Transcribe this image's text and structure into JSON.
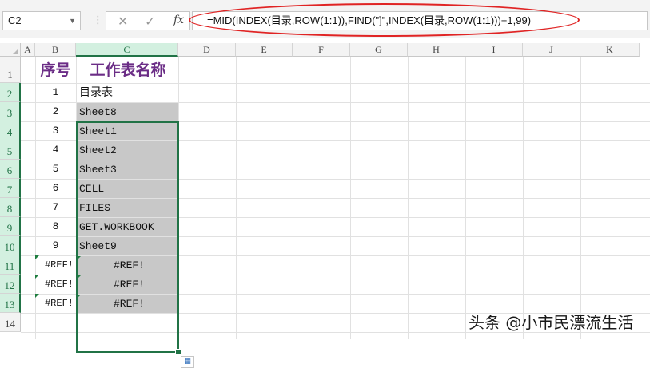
{
  "formula_bar": {
    "name_box": "C2",
    "formula": "=MID(INDEX(目录,ROW(1:1)),FIND(\"]\",INDEX(目录,ROW(1:1)))+1,99)",
    "cancel_icon": "✕",
    "confirm_icon": "✓",
    "fx_label": "fx",
    "separator": "⋮",
    "dropdown_icon": "▼"
  },
  "columns": [
    "A",
    "B",
    "C",
    "D",
    "E",
    "F",
    "G",
    "H",
    "I",
    "J",
    "K"
  ],
  "rows": [
    "1",
    "2",
    "3",
    "4",
    "5",
    "6",
    "7",
    "8",
    "9",
    "10",
    "11",
    "12",
    "13",
    "14"
  ],
  "cells": {
    "B1": "序号",
    "C1": "工作表名称",
    "B": [
      "1",
      "2",
      "3",
      "4",
      "5",
      "6",
      "7",
      "8",
      "9",
      "#REF!",
      "#REF!",
      "#REF!"
    ],
    "C": [
      "目录表",
      "Sheet8",
      "Sheet1",
      "Sheet2",
      "Sheet3",
      "CELL",
      "FILES",
      "GET.WORKBOOK",
      "Sheet9",
      "#REF!",
      "#REF!",
      "#REF!"
    ]
  },
  "selected_cell": "C2",
  "colors": {
    "header_text": "#6b2d86",
    "selection": "#217346",
    "highlight_fill": "#c8c8c8",
    "annotation_ellipse": "#e02424"
  },
  "watermark": "头条 @小市民漂流生活"
}
